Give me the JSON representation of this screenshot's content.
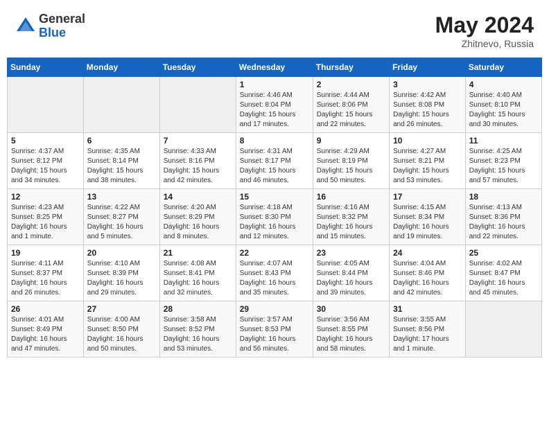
{
  "header": {
    "logo_general": "General",
    "logo_blue": "Blue",
    "month_year": "May 2024",
    "location": "Zhitnevo, Russia"
  },
  "weekdays": [
    "Sunday",
    "Monday",
    "Tuesday",
    "Wednesday",
    "Thursday",
    "Friday",
    "Saturday"
  ],
  "weeks": [
    [
      {
        "day": "",
        "info": ""
      },
      {
        "day": "",
        "info": ""
      },
      {
        "day": "",
        "info": ""
      },
      {
        "day": "1",
        "info": "Sunrise: 4:46 AM\nSunset: 8:04 PM\nDaylight: 15 hours\nand 17 minutes."
      },
      {
        "day": "2",
        "info": "Sunrise: 4:44 AM\nSunset: 8:06 PM\nDaylight: 15 hours\nand 22 minutes."
      },
      {
        "day": "3",
        "info": "Sunrise: 4:42 AM\nSunset: 8:08 PM\nDaylight: 15 hours\nand 26 minutes."
      },
      {
        "day": "4",
        "info": "Sunrise: 4:40 AM\nSunset: 8:10 PM\nDaylight: 15 hours\nand 30 minutes."
      }
    ],
    [
      {
        "day": "5",
        "info": "Sunrise: 4:37 AM\nSunset: 8:12 PM\nDaylight: 15 hours\nand 34 minutes."
      },
      {
        "day": "6",
        "info": "Sunrise: 4:35 AM\nSunset: 8:14 PM\nDaylight: 15 hours\nand 38 minutes."
      },
      {
        "day": "7",
        "info": "Sunrise: 4:33 AM\nSunset: 8:16 PM\nDaylight: 15 hours\nand 42 minutes."
      },
      {
        "day": "8",
        "info": "Sunrise: 4:31 AM\nSunset: 8:17 PM\nDaylight: 15 hours\nand 46 minutes."
      },
      {
        "day": "9",
        "info": "Sunrise: 4:29 AM\nSunset: 8:19 PM\nDaylight: 15 hours\nand 50 minutes."
      },
      {
        "day": "10",
        "info": "Sunrise: 4:27 AM\nSunset: 8:21 PM\nDaylight: 15 hours\nand 53 minutes."
      },
      {
        "day": "11",
        "info": "Sunrise: 4:25 AM\nSunset: 8:23 PM\nDaylight: 15 hours\nand 57 minutes."
      }
    ],
    [
      {
        "day": "12",
        "info": "Sunrise: 4:23 AM\nSunset: 8:25 PM\nDaylight: 16 hours\nand 1 minute."
      },
      {
        "day": "13",
        "info": "Sunrise: 4:22 AM\nSunset: 8:27 PM\nDaylight: 16 hours\nand 5 minutes."
      },
      {
        "day": "14",
        "info": "Sunrise: 4:20 AM\nSunset: 8:29 PM\nDaylight: 16 hours\nand 8 minutes."
      },
      {
        "day": "15",
        "info": "Sunrise: 4:18 AM\nSunset: 8:30 PM\nDaylight: 16 hours\nand 12 minutes."
      },
      {
        "day": "16",
        "info": "Sunrise: 4:16 AM\nSunset: 8:32 PM\nDaylight: 16 hours\nand 15 minutes."
      },
      {
        "day": "17",
        "info": "Sunrise: 4:15 AM\nSunset: 8:34 PM\nDaylight: 16 hours\nand 19 minutes."
      },
      {
        "day": "18",
        "info": "Sunrise: 4:13 AM\nSunset: 8:36 PM\nDaylight: 16 hours\nand 22 minutes."
      }
    ],
    [
      {
        "day": "19",
        "info": "Sunrise: 4:11 AM\nSunset: 8:37 PM\nDaylight: 16 hours\nand 26 minutes."
      },
      {
        "day": "20",
        "info": "Sunrise: 4:10 AM\nSunset: 8:39 PM\nDaylight: 16 hours\nand 29 minutes."
      },
      {
        "day": "21",
        "info": "Sunrise: 4:08 AM\nSunset: 8:41 PM\nDaylight: 16 hours\nand 32 minutes."
      },
      {
        "day": "22",
        "info": "Sunrise: 4:07 AM\nSunset: 8:43 PM\nDaylight: 16 hours\nand 35 minutes."
      },
      {
        "day": "23",
        "info": "Sunrise: 4:05 AM\nSunset: 8:44 PM\nDaylight: 16 hours\nand 39 minutes."
      },
      {
        "day": "24",
        "info": "Sunrise: 4:04 AM\nSunset: 8:46 PM\nDaylight: 16 hours\nand 42 minutes."
      },
      {
        "day": "25",
        "info": "Sunrise: 4:02 AM\nSunset: 8:47 PM\nDaylight: 16 hours\nand 45 minutes."
      }
    ],
    [
      {
        "day": "26",
        "info": "Sunrise: 4:01 AM\nSunset: 8:49 PM\nDaylight: 16 hours\nand 47 minutes."
      },
      {
        "day": "27",
        "info": "Sunrise: 4:00 AM\nSunset: 8:50 PM\nDaylight: 16 hours\nand 50 minutes."
      },
      {
        "day": "28",
        "info": "Sunrise: 3:58 AM\nSunset: 8:52 PM\nDaylight: 16 hours\nand 53 minutes."
      },
      {
        "day": "29",
        "info": "Sunrise: 3:57 AM\nSunset: 8:53 PM\nDaylight: 16 hours\nand 56 minutes."
      },
      {
        "day": "30",
        "info": "Sunrise: 3:56 AM\nSunset: 8:55 PM\nDaylight: 16 hours\nand 58 minutes."
      },
      {
        "day": "31",
        "info": "Sunrise: 3:55 AM\nSunset: 8:56 PM\nDaylight: 17 hours\nand 1 minute."
      },
      {
        "day": "",
        "info": ""
      }
    ]
  ]
}
